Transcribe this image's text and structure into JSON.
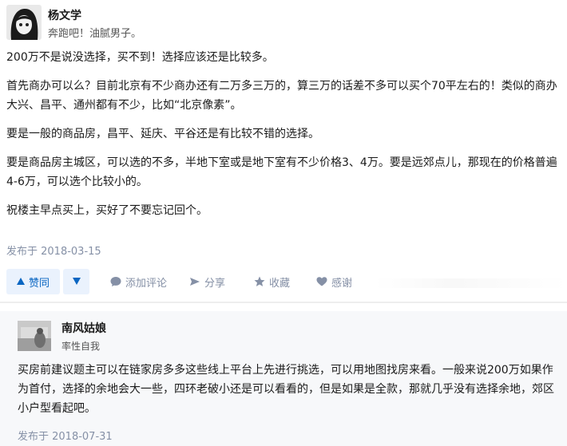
{
  "answer": {
    "author_name": "杨文学",
    "author_bio": "奔跑吧！油腻男子。",
    "paragraphs": [
      "200万不是说没选择，买不到！选择应该还是比较多。",
      "首先商办可以么？目前北京有不少商办还有二万多三万的，算三万的话差不多可以买个70平左右的！类似的商办大兴、昌平、通州都有不少，比如“北京像素”。",
      "要是一般的商品房，昌平、延庆、平谷还是有比较不错的选择。",
      "要是商品房主城区，可以选的不多，半地下室或是地下室有不少价格3、4万。要是远郊点儿，那现在的价格普遍4-6万，可以选个比较小的。",
      "祝楼主早点买上，买好了不要忘记回个。"
    ],
    "publish_date": "发布于 2018-03-15"
  },
  "actions": {
    "vote_up": "赞同",
    "comment": "添加评论",
    "share": "分享",
    "favorite": "收藏",
    "thanks": "感谢"
  },
  "icons": {
    "vote_up": "triangle-up-icon",
    "vote_down": "triangle-down-icon",
    "comment": "comment-bubble-icon",
    "share": "share-arrow-icon",
    "favorite": "star-icon",
    "thanks": "heart-icon"
  },
  "colors": {
    "accent": "#0a66c2",
    "vote_bg": "#eaf2fd",
    "meta": "#8590a6",
    "reply_bg": "#f7f8fa"
  },
  "reply": {
    "author_name": "南风姑娘",
    "author_bio": "率性自我",
    "content": "买房前建议题主可以在链家房多多这些线上平台上先进行挑选，可以用地图找房来看。一般来说200万如果作为首付，选择的余地会大一些，四环老破小还是可以看看的，但是如果是全款，那就几乎没有选择余地，郊区小户型看起吧。",
    "publish_date": "发布于 2018-07-31"
  }
}
